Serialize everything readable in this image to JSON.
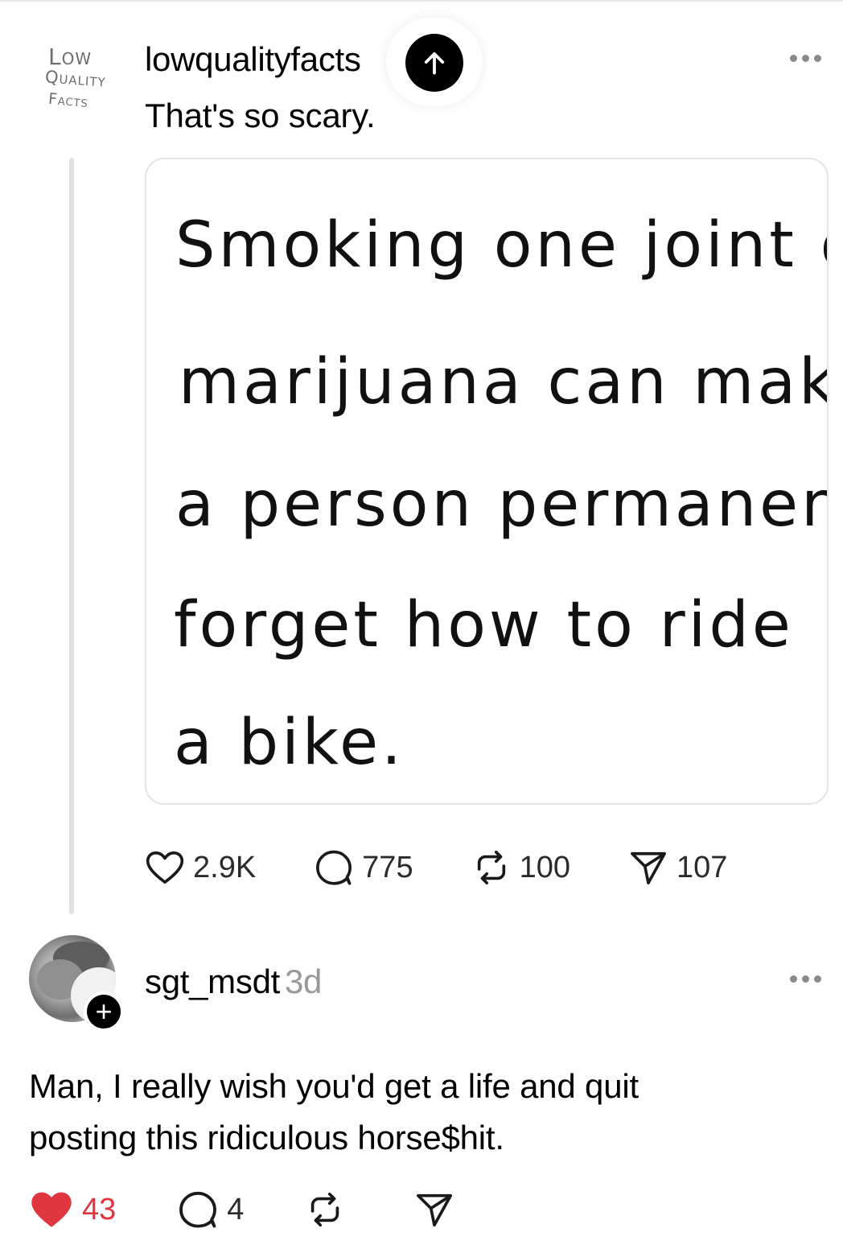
{
  "post": {
    "avatar_logo": {
      "line1": "Low",
      "line2": "Quality",
      "line3": "Facts"
    },
    "username": "lowqualityfacts",
    "text": "That's so scary.",
    "image_text_lines": [
      "Smoking  one  joint  of",
      "marijuana  can  make",
      "a  person  permanently",
      "forget  how  to  ride",
      "a  bike."
    ],
    "actions": {
      "likes": "2.9K",
      "replies": "775",
      "reposts": "100",
      "shares": "107"
    }
  },
  "comment": {
    "username": "sgt_msdt",
    "time": "3d",
    "text": "Man, I really wish you'd get a life and quit posting this ridiculous horse$hit.",
    "actions": {
      "likes": "43",
      "replies": "4"
    },
    "liked": true
  },
  "icons": {
    "scroll_top": "arrow-up-icon",
    "more": "more-horizontal-icon",
    "like": "heart-icon",
    "reply": "comment-icon",
    "repost": "repost-icon",
    "share": "send-icon",
    "follow": "plus-icon"
  },
  "colors": {
    "like_red": "#e0363f",
    "muted": "#999999",
    "border": "#e4e4e4"
  }
}
